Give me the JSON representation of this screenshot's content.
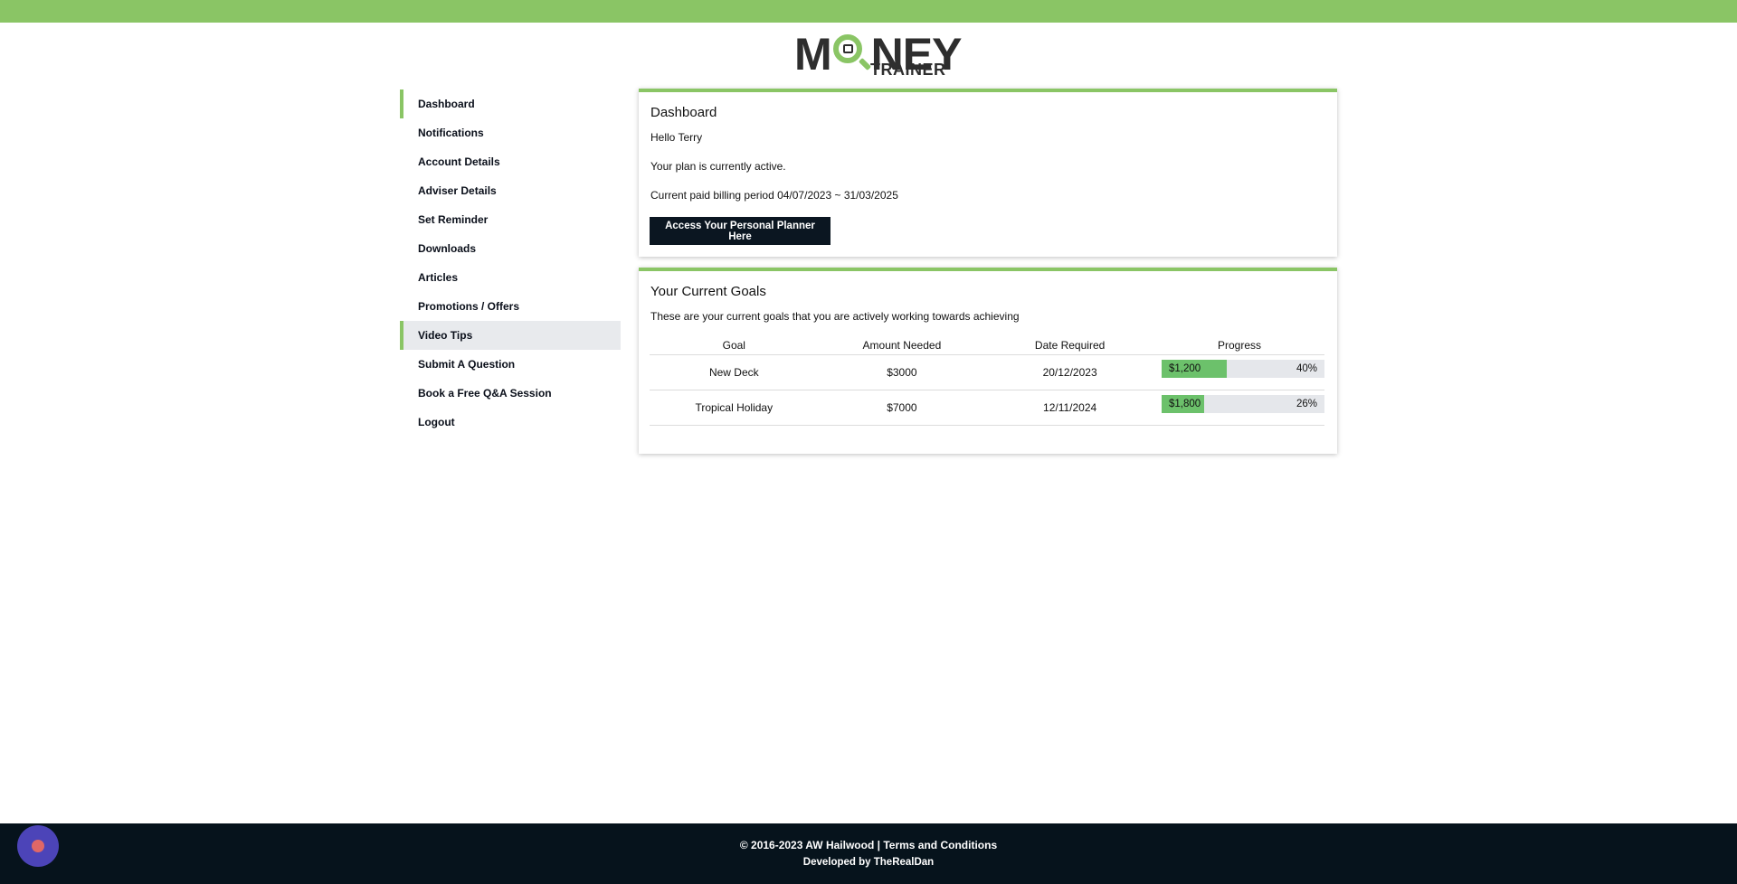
{
  "colors": {
    "accent": "#8ac565",
    "dark": "#0b1621",
    "progress_fill": "#6cc16b",
    "progress_track": "#e5e7eb",
    "footer_bg": "#06131c",
    "chat_bubble": "#4c44b8"
  },
  "logo": {
    "word1": "MONEY",
    "word2": "TRAINER"
  },
  "sidebar": {
    "active": "Dashboard",
    "hovered": "Video Tips",
    "items": [
      {
        "label": "Dashboard"
      },
      {
        "label": "Notifications"
      },
      {
        "label": "Account Details"
      },
      {
        "label": "Adviser Details"
      },
      {
        "label": "Set Reminder"
      },
      {
        "label": "Downloads"
      },
      {
        "label": "Articles"
      },
      {
        "label": "Promotions / Offers"
      },
      {
        "label": "Video Tips"
      },
      {
        "label": "Submit A Question"
      },
      {
        "label": "Book a Free Q&A Session"
      },
      {
        "label": "Logout"
      }
    ]
  },
  "dashboard": {
    "title": "Dashboard",
    "greeting": "Hello Terry",
    "plan_status": "Your plan is currently active.",
    "billing_period": "Current paid billing period 04/07/2023 ~ 31/03/2025",
    "planner_button": "Access Your Personal Planner Here"
  },
  "goals": {
    "title": "Your Current Goals",
    "subtitle": "These are your current goals that you are actively working towards achieving",
    "headers": {
      "goal": "Goal",
      "amount": "Amount Needed",
      "date": "Date Required",
      "progress": "Progress"
    },
    "rows": [
      {
        "goal": "New Deck",
        "amount": "$3000",
        "date": "20/12/2023",
        "saved": "$1,200",
        "percent_label": "40%",
        "percent": 40
      },
      {
        "goal": "Tropical Holiday",
        "amount": "$7000",
        "date": "12/11/2024",
        "saved": "$1,800",
        "percent_label": "26%",
        "percent": 26
      }
    ]
  },
  "footer": {
    "copyright": "© 2016-2023 AW Hailwood",
    "separator": "|",
    "terms": "Terms and Conditions",
    "developed_prefix": "Developed by",
    "developer": "TheRealDan"
  }
}
